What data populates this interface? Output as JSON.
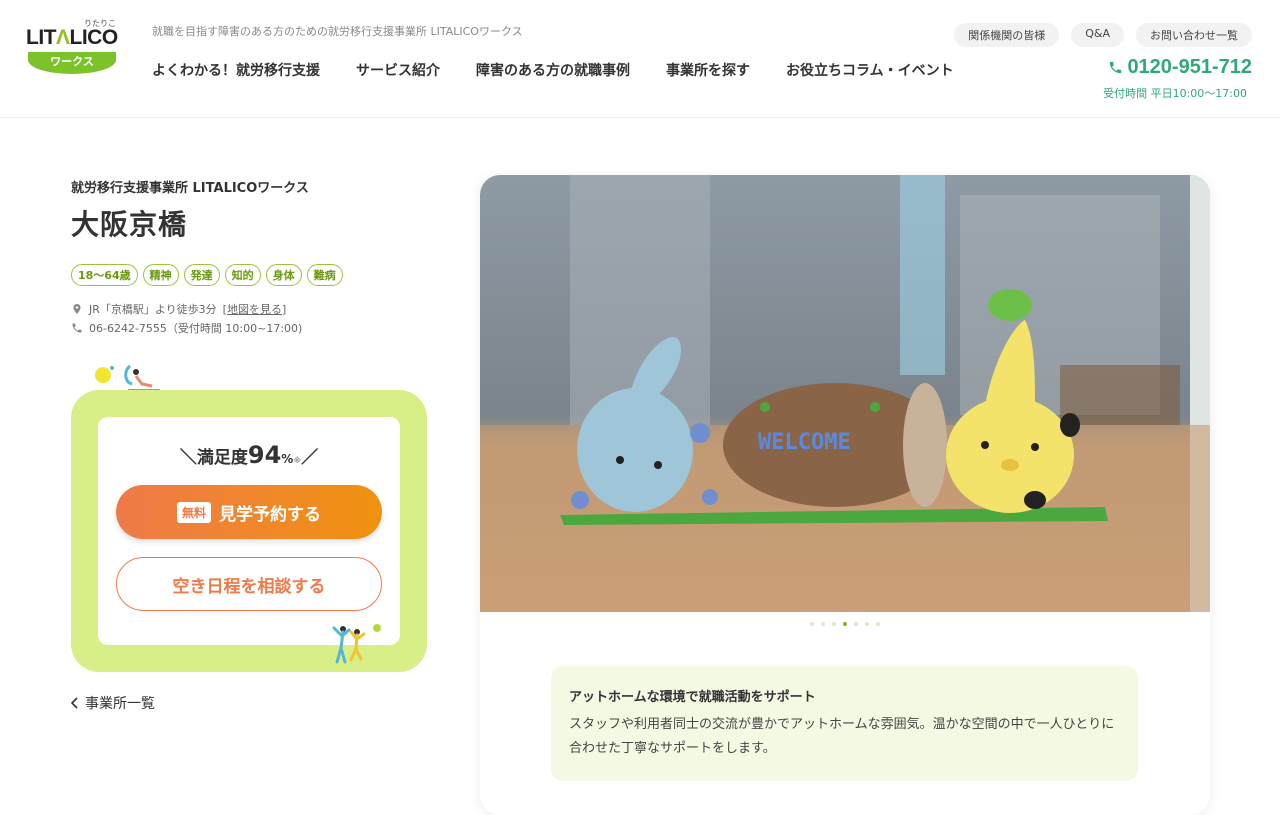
{
  "header": {
    "logo_text": "LITALICO",
    "logo_ruby": "りたりこ",
    "logo_sub": "ワークス",
    "tagline": "就職を目指す障害のある方のための就労移行支援事業所 LITALICOワークス",
    "nav": [
      "よくわかる！就労移行支援",
      "サービス紹介",
      "障害のある方の就職事例",
      "事業所を探す",
      "お役立ちコラム・イベント"
    ],
    "subnav": [
      "関係機関の皆様",
      "Q&A",
      "お問い合わせ一覧"
    ],
    "tel": "0120-951-712",
    "tel_hours": "受付時間 平日10:00〜17:00"
  },
  "office": {
    "company": "就労移行支援事業所 LITALICOワークス",
    "name": "大阪京橋",
    "tags": [
      "18〜64歳",
      "精神",
      "発達",
      "知的",
      "身体",
      "難病"
    ],
    "access": "JR「京橋駅」より徒歩3分",
    "map_link": "地図を見る",
    "phone": "06-6242-7555（受付時間 10:00~17:00)"
  },
  "cta": {
    "satisfaction_prefix": "＼満足度",
    "satisfaction_value": "94",
    "satisfaction_unit": "%",
    "satisfaction_note": "※",
    "satisfaction_suffix": "／",
    "free_badge": "無料",
    "primary_button": "見学予約する",
    "secondary_button": "空き日程を相談する"
  },
  "back_link": "事業所一覧",
  "carousel": {
    "photo_text": "WELCOME",
    "slide_count": 7,
    "active_index": 3
  },
  "feature": {
    "title": "アットホームな環境で就職活動をサポート",
    "body": "スタッフや利用者同士の交流が豊かでアットホームな雰囲気。温かな空間の中で一人ひとりに合わせた丁寧なサポートをします。"
  },
  "colors": {
    "brand_green": "#8dc21f",
    "tel_green": "#2fa87a",
    "cta_orange": "#ef7a4a",
    "panel_lime": "#d8ee86"
  }
}
